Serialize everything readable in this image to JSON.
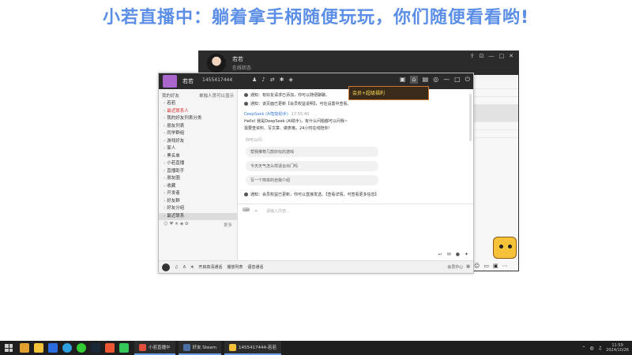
{
  "banner": {
    "text": "小若直播中：躺着拿手柄随便玩玩，你们随便看看哟!"
  },
  "back_window": {
    "name": "若若",
    "subtitle": "在线状态"
  },
  "main_window": {
    "nickname": "若若",
    "account": "1455417444",
    "ad_label": "会员+超级福利",
    "sidebar": {
      "header_left": "我的好友",
      "header_right": "单独人员可以显示",
      "items": [
        {
          "label": "若若",
          "style": "normal"
        },
        {
          "label": "最近联系人",
          "style": "red"
        },
        {
          "label": "我的好友列表分类",
          "style": "normal"
        },
        {
          "label": "朋友列表",
          "style": "normal"
        },
        {
          "label": "同学群组",
          "style": "normal"
        },
        {
          "label": "游戏好友",
          "style": "normal"
        },
        {
          "label": "家人",
          "style": "normal"
        },
        {
          "label": "黑名单",
          "style": "normal"
        },
        {
          "label": "小若直播",
          "style": "normal"
        },
        {
          "label": "直播助手",
          "style": "normal"
        },
        {
          "label": "朋友圈",
          "style": "normal"
        },
        {
          "label": "收藏",
          "style": "normal"
        },
        {
          "label": "开发者",
          "style": "normal"
        },
        {
          "label": "好友群",
          "style": "normal"
        },
        {
          "label": "好友分组",
          "style": "normal"
        },
        {
          "label": "最近联系",
          "style": "sel"
        }
      ],
      "tag_right": "更多"
    },
    "chat": {
      "sys1": "通知：有好友请求已添加，你可以随便聊聊。",
      "sys2": "通知：该页面已更新【会员权益说明】，可在设置中查看。",
      "bot_name": "DeepSeek (AI智能助手)",
      "bot_time": "17:55:40",
      "bot_msg1": "Hello! 我是DeepSeek (AI助手)，有什么问题都可以问我~",
      "bot_msg2": "需要查资料、写文章、做表格，24小时在线陪你！",
      "guess_label": "你可以问：",
      "chips": [
        "帮我推荐几款好玩的游戏",
        "今天天气怎么样适合出门吗",
        "写一个简单的自我介绍"
      ],
      "sys3": "通知：会员权益已更新，你可以直接发送。【查看详情，可查看更多信息】",
      "input_placeholder": "请输入内容..."
    },
    "bottombar": {
      "btn1": "开启高清通话",
      "btn2": "播放列表",
      "btn3": "语音通话",
      "right": "会员中心"
    }
  },
  "taskbar": {
    "tasks": [
      {
        "label": "小若直播中",
        "color": "#e0503a"
      },
      {
        "label": "好友 Steam",
        "color": "#4a6fa5"
      },
      {
        "label": "1455417444-若若",
        "color": "#f5c23a"
      }
    ],
    "time": "11:59",
    "date": "2024/10/26"
  }
}
